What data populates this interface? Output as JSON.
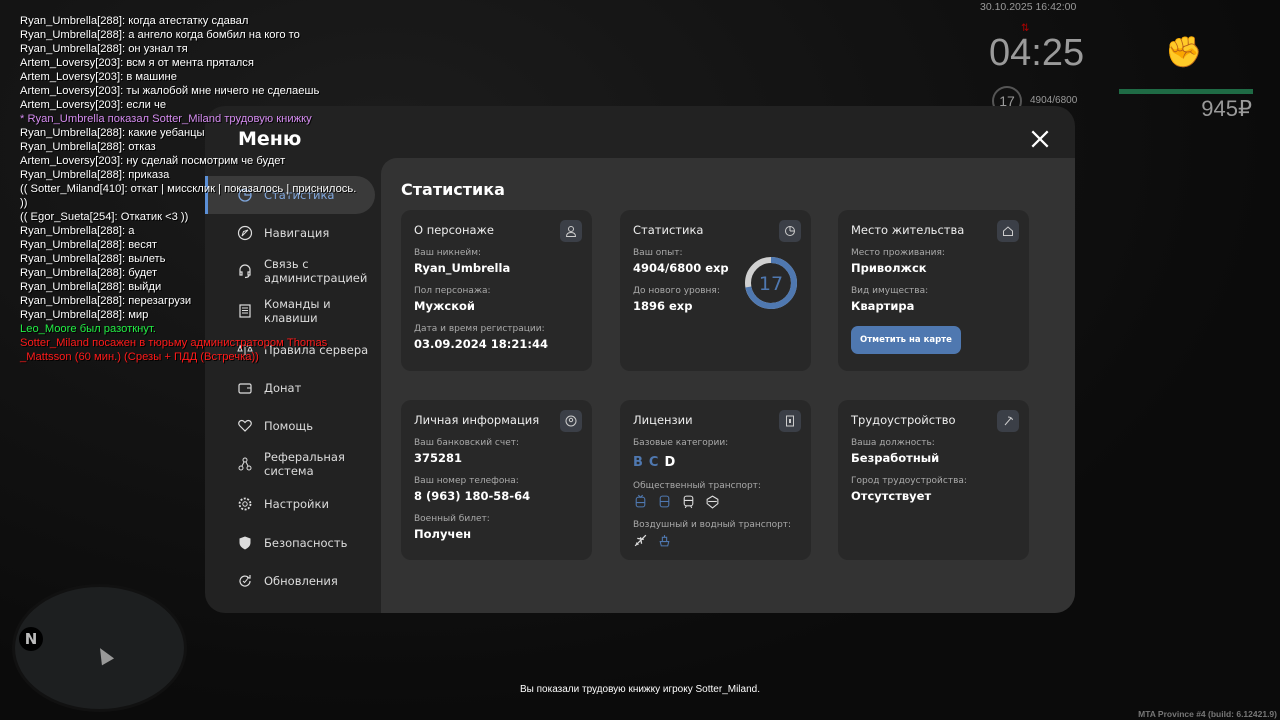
{
  "hud": {
    "datetime": "30.10.2025 16:42:00",
    "clock": "04:25",
    "level": "17",
    "exp": "4904/6800",
    "money": "945₽",
    "build": "MTA Province #4 (build: 6.12421.9)",
    "notice": "Вы показали трудовую книжку игроку Sotter_Miland.",
    "health_color": "#1f6b45"
  },
  "chat": [
    {
      "t": "Ryan_Umbrella[288]: когда атестатку сдавал",
      "c": "#ffffff"
    },
    {
      "t": "Ryan_Umbrella[288]: а ангело когда бомбил на кого то",
      "c": "#ffffff"
    },
    {
      "t": "Ryan_Umbrella[288]: он узнал тя",
      "c": "#ffffff"
    },
    {
      "t": "Artem_Loversy[203]: всм я от мента прятался",
      "c": "#ffffff"
    },
    {
      "t": "Artem_Loversy[203]: в машине",
      "c": "#ffffff"
    },
    {
      "t": "Artem_Loversy[203]: ты жалобой мне ничего не сделаешь",
      "c": "#ffffff"
    },
    {
      "t": "Artem_Loversy[203]: если че",
      "c": "#ffffff"
    },
    {
      "t": "* Ryan_Umbrella показал Sotter_Miland трудовую книжку",
      "c": "#d58cf0"
    },
    {
      "t": "Ryan_Umbrella[288]: какие уебанцы",
      "c": "#ffffff"
    },
    {
      "t": "Ryan_Umbrella[288]: отказ",
      "c": "#ffffff"
    },
    {
      "t": "Artem_Loversy[203]: ну сделай посмотрим че будет",
      "c": "#ffffff"
    },
    {
      "t": "Ryan_Umbrella[288]: приказа",
      "c": "#ffffff"
    },
    {
      "t": "(( Sotter_Miland[410]: откат | миссклик | показалось | приснилось.",
      "c": "#ffffff"
    },
    {
      "t": "))",
      "c": "#ffffff"
    },
    {
      "t": "(( Egor_Sueta[254]: Откатик <3 ))",
      "c": "#ffffff"
    },
    {
      "t": "Ryan_Umbrella[288]: а",
      "c": "#ffffff"
    },
    {
      "t": "Ryan_Umbrella[288]: весят",
      "c": "#ffffff"
    },
    {
      "t": "Ryan_Umbrella[288]: вылеть",
      "c": "#ffffff"
    },
    {
      "t": "Ryan_Umbrella[288]: будет",
      "c": "#ffffff"
    },
    {
      "t": "Ryan_Umbrella[288]: выйди",
      "c": "#ffffff"
    },
    {
      "t": "Ryan_Umbrella[288]: перезагрузи",
      "c": "#ffffff"
    },
    {
      "t": "Ryan_Umbrella[288]: мир",
      "c": "#ffffff"
    },
    {
      "t": "Leo_Moore был разоткнут.",
      "c": "#22ee44"
    },
    {
      "t": "Sotter_Miland посажен в тюрьму администратором Thomas",
      "c": "#ff1a1a"
    },
    {
      "t": "_Mattsson (60 мин.) (Срезы + ПДД (Встречка))",
      "c": "#ff1a1a"
    }
  ],
  "menu": {
    "title": "Меню",
    "items": [
      {
        "label": "Статистика",
        "icon": "chart-icon",
        "active": true
      },
      {
        "label": "Навигация",
        "icon": "compass-icon"
      },
      {
        "label": "Связь с администрацией",
        "icon": "headset-icon"
      },
      {
        "label": "Команды и клавиши",
        "icon": "document-icon"
      },
      {
        "label": "Правила сервера",
        "icon": "scales-icon"
      },
      {
        "label": "Донат",
        "icon": "wallet-icon"
      },
      {
        "label": "Помощь",
        "icon": "heart-hands-icon"
      },
      {
        "label": "Реферальная система",
        "icon": "network-icon"
      },
      {
        "label": "Настройки",
        "icon": "gear-icon"
      },
      {
        "label": "Безопасность",
        "icon": "shield-icon"
      },
      {
        "label": "Обновления",
        "icon": "refresh-icon"
      }
    ]
  },
  "stats": {
    "title": "Статистика",
    "character": {
      "title": "О персонаже",
      "icon": "user-icon",
      "nick_label": "Ваш никнейм:",
      "nick": "Ryan_Umbrella",
      "sex_label": "Пол персонажа:",
      "sex": "Мужской",
      "reg_label": "Дата и время регистрации:",
      "reg": "03.09.2024 18:21:44"
    },
    "stat": {
      "title": "Статистика",
      "icon": "pie-icon",
      "exp_label": "Ваш опыт:",
      "exp": "4904/6800 exp",
      "next_label": "До нового уровня:",
      "next": "1896 exp",
      "level": "17",
      "progress": 0.721
    },
    "home": {
      "title": "Место жительства",
      "icon": "home-icon",
      "place_label": "Место проживания:",
      "place": "Приволжск",
      "type_label": "Вид имущества:",
      "type": "Квартира",
      "button": "Отметить на карте"
    },
    "personal": {
      "title": "Личная информация",
      "icon": "id-icon",
      "bank_label": "Ваш банковский счет:",
      "bank": "375281",
      "phone_label": "Ваш номер телефона:",
      "phone": "8 (963) 180-58-64",
      "military_label": "Военный билет:",
      "military": "Получен"
    },
    "licenses": {
      "title": "Лицензии",
      "icon": "license-icon",
      "base_label": "Базовые категории:",
      "categories": [
        {
          "l": "B",
          "c": "#4f78b0"
        },
        {
          "l": "C",
          "c": "#4f78b0"
        },
        {
          "l": "D",
          "c": "#ffffff"
        }
      ],
      "public_label": "Общественный транспорт:",
      "public": [
        {
          "icon": "trolleybus-icon",
          "c": "#4f78b0"
        },
        {
          "icon": "bus-icon",
          "c": "#4f78b0"
        },
        {
          "icon": "train-icon",
          "c": "#dddddd"
        },
        {
          "icon": "taxi-icon",
          "c": "#dddddd"
        }
      ],
      "air_label": "Воздушный и водный транспорт:",
      "air": [
        {
          "icon": "plane-icon",
          "c": "#dddddd"
        },
        {
          "icon": "ship-icon",
          "c": "#4f78b0"
        }
      ]
    },
    "job": {
      "title": "Трудоустройство",
      "icon": "pickaxe-icon",
      "post_label": "Ваша должность:",
      "post": "Безработный",
      "city_label": "Город трудоустройства:",
      "city": "Отсутствует"
    }
  }
}
